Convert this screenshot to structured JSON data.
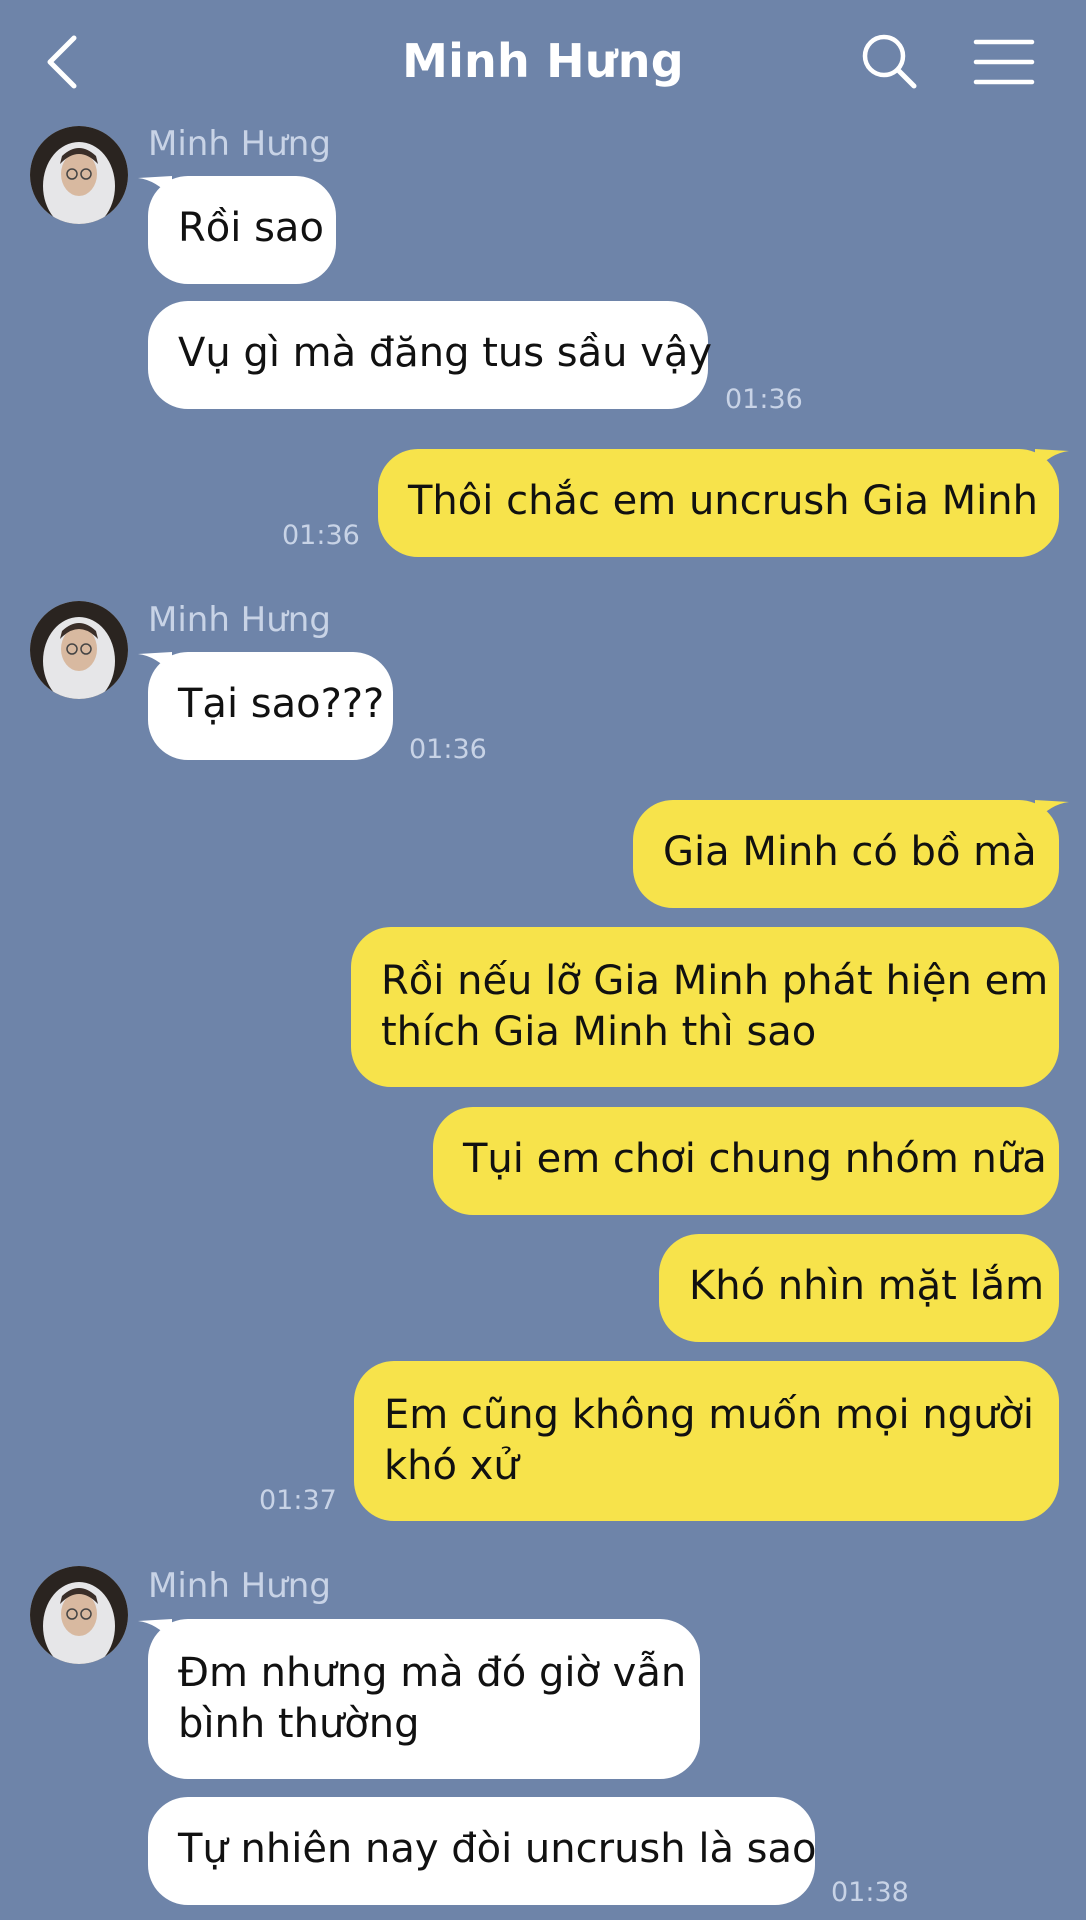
{
  "header": {
    "title": "Minh Hưng",
    "back_icon": "chevron-left-icon",
    "search_icon": "search-icon",
    "menu_icon": "menu-icon"
  },
  "colors": {
    "background": "#6e84a9",
    "incoming_bubble": "#ffffff",
    "outgoing_bubble": "#f7e34b",
    "meta_text": "#c8d3e6"
  },
  "messages": [
    {
      "sender": "Minh Hưng",
      "text": "Rồi sao",
      "dir": "in"
    },
    {
      "text": "Vụ gì mà đăng tus sầu vậy",
      "dir": "in",
      "time": "01:36"
    },
    {
      "text": "Thôi chắc em uncrush Gia Minh",
      "dir": "out",
      "time": "01:36"
    },
    {
      "sender": "Minh Hưng",
      "text": "Tại sao???",
      "dir": "in",
      "time": "01:36"
    },
    {
      "text": "Gia Minh có bồ mà",
      "dir": "out"
    },
    {
      "text_line1": "Rồi nếu lỡ Gia Minh phát hiện em",
      "text_line2": "thích Gia Minh thì sao",
      "dir": "out"
    },
    {
      "text": "Tụi em chơi chung nhóm nữa",
      "dir": "out"
    },
    {
      "text": "Khó nhìn mặt lắm",
      "dir": "out"
    },
    {
      "text_line1": "Em cũng không muốn mọi người",
      "text_line2": "khó xử",
      "dir": "out",
      "time": "01:37"
    },
    {
      "sender": "Minh Hưng",
      "text_line1": "Đm nhưng mà đó giờ vẫn",
      "text_line2": "bình thường",
      "dir": "in"
    },
    {
      "text": "Tự nhiên nay đòi uncrush là sao",
      "dir": "in",
      "time": "01:38"
    }
  ]
}
